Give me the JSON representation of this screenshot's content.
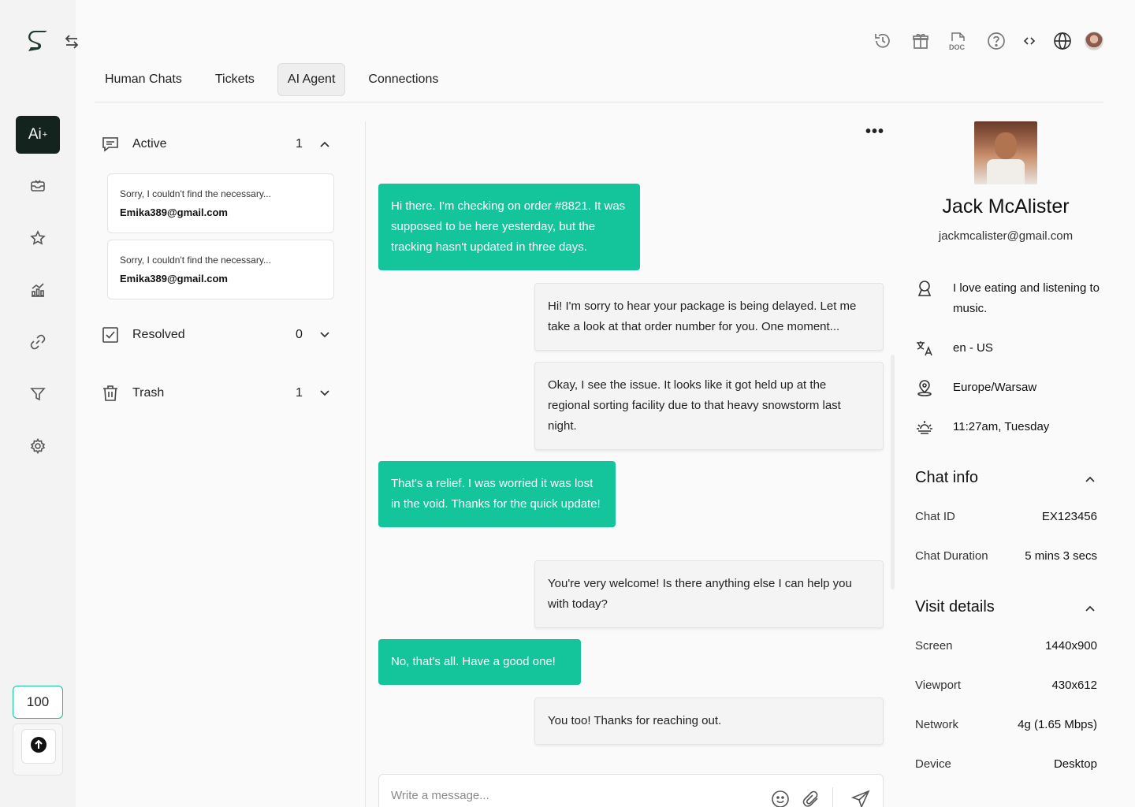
{
  "tabs": [
    {
      "label": "Human Chats",
      "active": false
    },
    {
      "label": "Tickets",
      "active": false
    },
    {
      "label": "AI Agent",
      "active": true
    },
    {
      "label": "Connections",
      "active": false
    }
  ],
  "rail": {
    "ai_label": "Ai",
    "credits": "100"
  },
  "folders": {
    "active": {
      "label": "Active",
      "count": "1"
    },
    "resolved": {
      "label": "Resolved",
      "count": "0"
    },
    "trash": {
      "label": "Trash",
      "count": "1"
    }
  },
  "conversations": [
    {
      "snippet": "Sorry, I couldn't find the necessary...",
      "email": "Emika389@gmail.com"
    },
    {
      "snippet": "Sorry, I couldn't find the necessary...",
      "email": "Emika389@gmail.com"
    }
  ],
  "messages": [
    {
      "from": "user",
      "text": "Hi there. I'm checking on order #8821. It was supposed to be here yesterday, but the tracking hasn't updated in three days."
    },
    {
      "from": "agent",
      "text": "Hi! I'm sorry to hear your package is being delayed. Let me take a look at that order number for you. One moment..."
    },
    {
      "from": "agent",
      "text": "Okay, I see the issue. It looks like it got held up at the regional sorting facility due to that heavy snowstorm last night."
    },
    {
      "from": "user",
      "text": "That's a relief. I was worried it was lost in the void. Thanks for the quick update!"
    },
    {
      "from": "agent",
      "text": "You're very welcome! Is there anything else I can help you with today?"
    },
    {
      "from": "user",
      "text": "No, that's all. Have a good one!"
    },
    {
      "from": "agent",
      "text": "You too! Thanks for reaching out."
    }
  ],
  "composer": {
    "placeholder": "Write a message..."
  },
  "profile": {
    "name": "Jack McAlister",
    "email": "jackmcalister@gmail.com",
    "bio": "I love eating and listening to music.",
    "language": "en - US",
    "timezone": "Europe/Warsaw",
    "local_time": "11:27am, Tuesday"
  },
  "chat_info": {
    "title": "Chat info",
    "chat_id_label": "Chat ID",
    "chat_id": "EX123456",
    "duration_label": "Chat Duration",
    "duration": "5 mins 3 secs"
  },
  "visit_details": {
    "title": "Visit details",
    "screen_label": "Screen",
    "screen": "1440x900",
    "viewport_label": "Viewport",
    "viewport": "430x612",
    "network_label": "Network",
    "network": "4g (1.65 Mbps)",
    "device_label": "Device",
    "device": "Desktop"
  },
  "colors": {
    "accent": "#14c49b",
    "rail_active": "#14231d"
  },
  "icons": [
    "logo-icon",
    "swap-arrows-icon",
    "ai-sparkle-icon",
    "inbox-icon",
    "star-icon",
    "analytics-icon",
    "link-icon",
    "filter-icon",
    "gear-icon",
    "arrow-up-icon",
    "history-icon",
    "gift-icon",
    "doc-icon",
    "help-icon",
    "code-icon",
    "globe-icon",
    "chat-bubble-icon",
    "checkbox-icon",
    "trash-icon",
    "chevron-up-icon",
    "chevron-down-icon",
    "more-dots-icon",
    "emoji-icon",
    "paperclip-icon",
    "send-icon",
    "person-icon",
    "translate-icon",
    "location-pin-icon",
    "sun-icon"
  ]
}
